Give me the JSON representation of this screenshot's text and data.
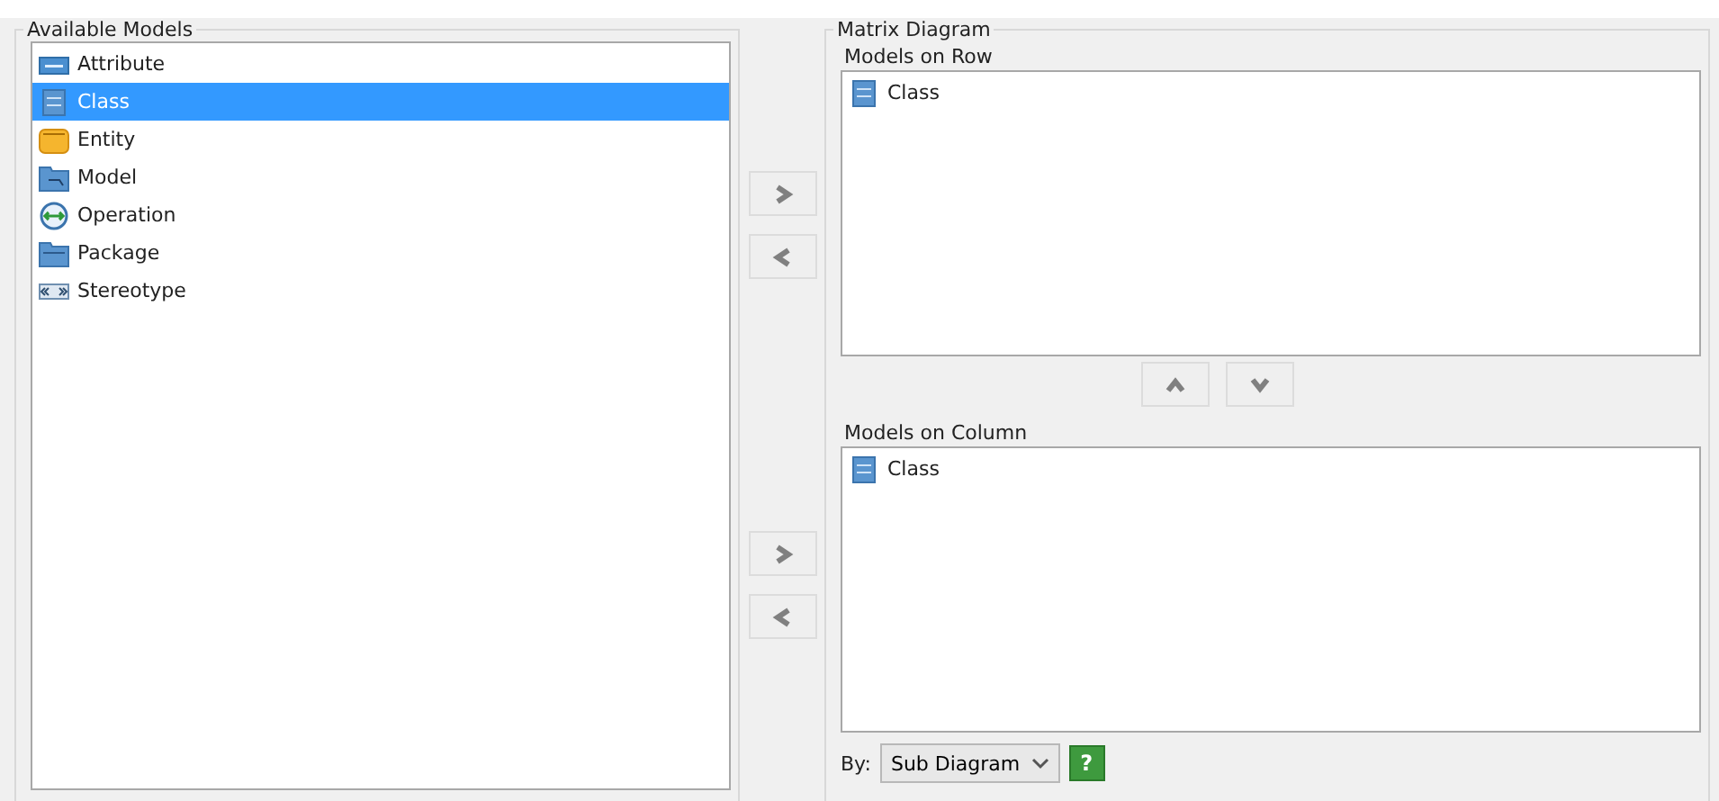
{
  "available_models": {
    "title": "Available Models",
    "items": [
      {
        "label": "Attribute",
        "kind": "attribute",
        "selected": false
      },
      {
        "label": "Class",
        "kind": "class",
        "selected": true
      },
      {
        "label": "Entity",
        "kind": "entity",
        "selected": false
      },
      {
        "label": "Model",
        "kind": "model",
        "selected": false
      },
      {
        "label": "Operation",
        "kind": "operation",
        "selected": false
      },
      {
        "label": "Package",
        "kind": "package",
        "selected": false
      },
      {
        "label": "Stereotype",
        "kind": "stereotype",
        "selected": false
      }
    ]
  },
  "matrix_diagram": {
    "title": "Matrix Diagram",
    "models_on_row": {
      "label": "Models on Row",
      "items": [
        {
          "label": "Class",
          "kind": "class",
          "selected": false
        }
      ]
    },
    "models_on_column": {
      "label": "Models on Column",
      "items": [
        {
          "label": "Class",
          "kind": "class",
          "selected": false
        }
      ]
    },
    "by": {
      "label": "By:",
      "value": "Sub Diagram",
      "help": "?"
    }
  }
}
